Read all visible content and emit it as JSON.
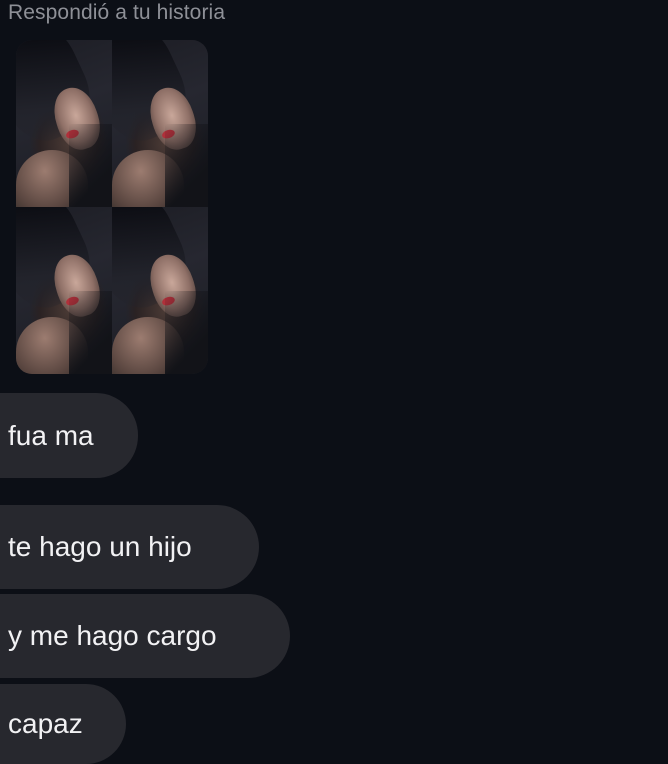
{
  "reply_header": "Respondió a tu historia",
  "story_thumbnail": {
    "alt": "Story image"
  },
  "messages": [
    {
      "text": "fua ma"
    },
    {
      "text": "te hago un hijo"
    },
    {
      "text": "y me hago cargo"
    },
    {
      "text": "capaz"
    }
  ],
  "colors": {
    "background": "#0c0f16",
    "bubble": "#27282e",
    "bubble_text": "#f2f2f4",
    "header_text": "#8e9097"
  }
}
